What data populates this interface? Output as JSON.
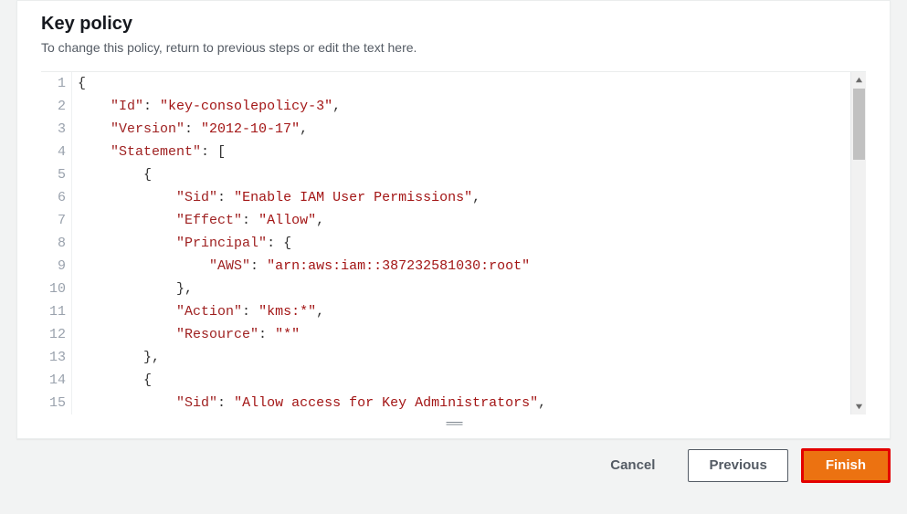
{
  "header": {
    "title": "Key policy",
    "subtitle": "To change this policy, return to previous steps or edit the text here."
  },
  "footer": {
    "cancel": "Cancel",
    "previous": "Previous",
    "finish": "Finish"
  },
  "code": {
    "line_start": 1,
    "lines": [
      [
        {
          "t": "punct",
          "v": "{"
        }
      ],
      [
        {
          "t": "indent",
          "v": "    "
        },
        {
          "t": "key",
          "v": "\"Id\""
        },
        {
          "t": "punct",
          "v": ": "
        },
        {
          "t": "str",
          "v": "\"key-consolepolicy-3\""
        },
        {
          "t": "punct",
          "v": ","
        }
      ],
      [
        {
          "t": "indent",
          "v": "    "
        },
        {
          "t": "key",
          "v": "\"Version\""
        },
        {
          "t": "punct",
          "v": ": "
        },
        {
          "t": "str",
          "v": "\"2012-10-17\""
        },
        {
          "t": "punct",
          "v": ","
        }
      ],
      [
        {
          "t": "indent",
          "v": "    "
        },
        {
          "t": "key",
          "v": "\"Statement\""
        },
        {
          "t": "punct",
          "v": ": ["
        }
      ],
      [
        {
          "t": "indent",
          "v": "        "
        },
        {
          "t": "punct",
          "v": "{"
        }
      ],
      [
        {
          "t": "indent",
          "v": "            "
        },
        {
          "t": "key",
          "v": "\"Sid\""
        },
        {
          "t": "punct",
          "v": ": "
        },
        {
          "t": "str",
          "v": "\"Enable IAM User Permissions\""
        },
        {
          "t": "punct",
          "v": ","
        }
      ],
      [
        {
          "t": "indent",
          "v": "            "
        },
        {
          "t": "key",
          "v": "\"Effect\""
        },
        {
          "t": "punct",
          "v": ": "
        },
        {
          "t": "str",
          "v": "\"Allow\""
        },
        {
          "t": "punct",
          "v": ","
        }
      ],
      [
        {
          "t": "indent",
          "v": "            "
        },
        {
          "t": "key",
          "v": "\"Principal\""
        },
        {
          "t": "punct",
          "v": ": {"
        }
      ],
      [
        {
          "t": "indent",
          "v": "                "
        },
        {
          "t": "key",
          "v": "\"AWS\""
        },
        {
          "t": "punct",
          "v": ": "
        },
        {
          "t": "str",
          "v": "\"arn:aws:iam::387232581030:root\""
        }
      ],
      [
        {
          "t": "indent",
          "v": "            "
        },
        {
          "t": "punct",
          "v": "},"
        }
      ],
      [
        {
          "t": "indent",
          "v": "            "
        },
        {
          "t": "key",
          "v": "\"Action\""
        },
        {
          "t": "punct",
          "v": ": "
        },
        {
          "t": "str",
          "v": "\"kms:*\""
        },
        {
          "t": "punct",
          "v": ","
        }
      ],
      [
        {
          "t": "indent",
          "v": "            "
        },
        {
          "t": "key",
          "v": "\"Resource\""
        },
        {
          "t": "punct",
          "v": ": "
        },
        {
          "t": "str",
          "v": "\"*\""
        }
      ],
      [
        {
          "t": "indent",
          "v": "        "
        },
        {
          "t": "punct",
          "v": "},"
        }
      ],
      [
        {
          "t": "indent",
          "v": "        "
        },
        {
          "t": "punct",
          "v": "{"
        }
      ],
      [
        {
          "t": "indent",
          "v": "            "
        },
        {
          "t": "key",
          "v": "\"Sid\""
        },
        {
          "t": "punct",
          "v": ": "
        },
        {
          "t": "str",
          "v": "\"Allow access for Key Administrators\""
        },
        {
          "t": "punct",
          "v": ","
        }
      ]
    ]
  }
}
